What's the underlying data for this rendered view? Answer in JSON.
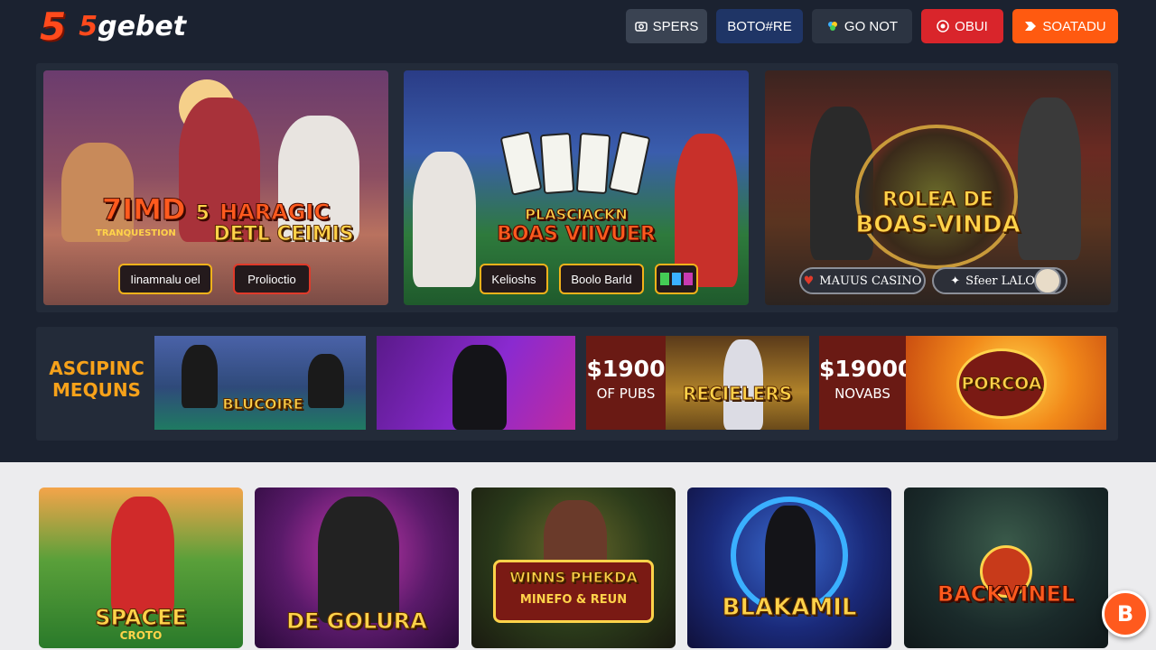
{
  "header": {
    "logo_mark": "5",
    "logo_text_accent": "5",
    "logo_text": "gebet",
    "nav": [
      {
        "label": "SPERS",
        "icon": "camera-icon",
        "color": "#3a4352"
      },
      {
        "label": "BOTO#RE",
        "icon": "",
        "color": "#1f3566"
      },
      {
        "label": "GO NOT",
        "icon": "color-wheel-icon",
        "color": "#2c3442"
      },
      {
        "label": "OBUI",
        "icon": "record-icon",
        "color": "#d9252b"
      },
      {
        "label": "SOATADU",
        "icon": "ticket-icon",
        "color": "#ff5a10"
      }
    ]
  },
  "hero": [
    {
      "title_line1": "7IMD",
      "title_badge": "5",
      "title_line1b": "HARAGIC",
      "title_sub": "TRANQUESTION",
      "title_line2": "DETL CEIMIS",
      "buttons": [
        "Iinamnalu oel",
        "Prolioctio"
      ]
    },
    {
      "title_line1": "PLASCIACKN",
      "title_line2": "BOAS VIIVUER",
      "buttons": [
        "Kelioshs",
        "Boolo Barld"
      ]
    },
    {
      "title_line1": "ROLEA DE",
      "title_line2": "BOAS-VINDA",
      "pills": [
        "MAUUS CASINO",
        "Sfeer LALOIO"
      ]
    }
  ],
  "promo": {
    "label": "ASCIPINC MEQUNS",
    "cards": [
      {
        "word": "BLUCOIRE"
      },
      {
        "word": ""
      },
      {
        "amount": "$1900",
        "caption": "OF PUBS",
        "word": "RECIELERS"
      },
      {
        "amount": "$19000",
        "caption": "NOVABS",
        "word": "PORCOA"
      }
    ]
  },
  "games": [
    {
      "title": "SPACEE",
      "subtitle": "CROTO"
    },
    {
      "title": "DE GOLURA",
      "subtitle": ""
    },
    {
      "title": "WINNS PHEKDA",
      "subtitle": "MINEFO & REUN"
    },
    {
      "title": "BLAKAMIL",
      "subtitle": ""
    },
    {
      "title": "BACKVINEL",
      "subtitle": ""
    }
  ],
  "chat": {
    "label": "B"
  },
  "colors": {
    "accent": "#ff5a1e",
    "gold": "#f2b21a",
    "dark_bg": "#1b2230",
    "light_bg": "#ececee"
  }
}
